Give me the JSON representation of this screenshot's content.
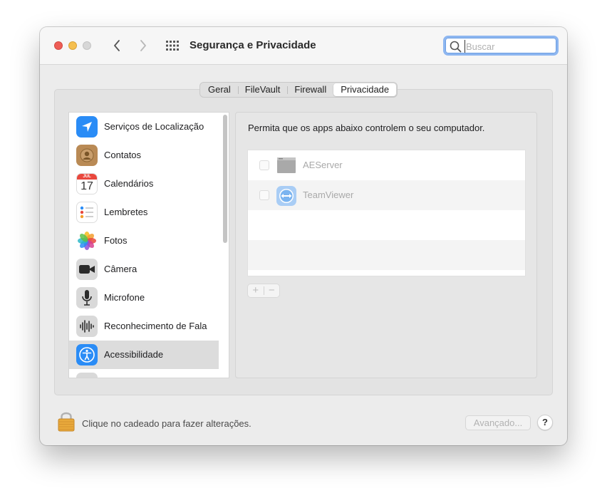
{
  "window": {
    "title": "Segurança e Privacidade"
  },
  "search": {
    "placeholder": "Buscar",
    "value": ""
  },
  "tabs": [
    {
      "label": "Geral",
      "active": false
    },
    {
      "label": "FileVault",
      "active": false
    },
    {
      "label": "Firewall",
      "active": false
    },
    {
      "label": "Privacidade",
      "active": true
    }
  ],
  "sidebar": {
    "items": [
      {
        "label": "Serviços de Localização",
        "icon": "location-arrow-icon"
      },
      {
        "label": "Contatos",
        "icon": "contacts-icon"
      },
      {
        "label": "Calendários",
        "icon": "calendar-icon",
        "month": "JUL",
        "day": "17"
      },
      {
        "label": "Lembretes",
        "icon": "reminders-icon"
      },
      {
        "label": "Fotos",
        "icon": "photos-icon"
      },
      {
        "label": "Câmera",
        "icon": "camera-icon"
      },
      {
        "label": "Microfone",
        "icon": "microphone-icon"
      },
      {
        "label": "Reconhecimento de Fala",
        "icon": "speech-waveform-icon"
      },
      {
        "label": "Acessibilidade",
        "icon": "accessibility-icon",
        "selected": true
      }
    ]
  },
  "detail": {
    "description": "Permita que os apps abaixo controlem o seu computador.",
    "apps": [
      {
        "name": "AEServer",
        "checked": false,
        "icon": "aeserver-icon"
      },
      {
        "name": "TeamViewer",
        "checked": false,
        "icon": "teamviewer-icon"
      }
    ],
    "add_label": "+",
    "remove_label": "−"
  },
  "footer": {
    "lock_text": "Clique no cadeado para fazer alterações.",
    "advanced_label": "Avançado...",
    "help_label": "?"
  },
  "colors": {
    "close": "#ee5d56",
    "minimize": "#f5bf4f",
    "accent_focus": "#8db6f0",
    "selected_row": "#dcdcdc"
  }
}
